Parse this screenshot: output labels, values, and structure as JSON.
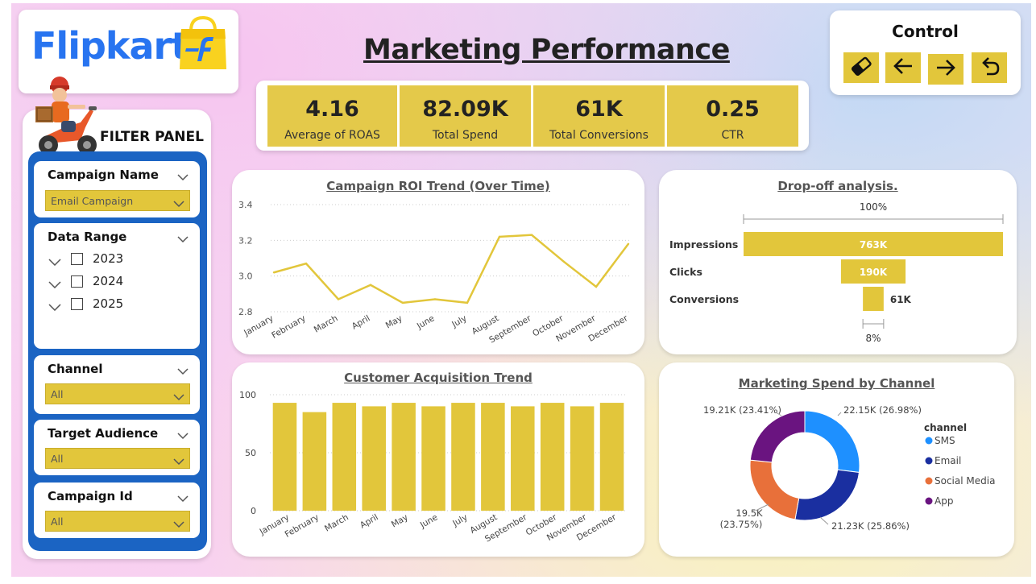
{
  "brand": {
    "name": "Flipkart",
    "color": "#2874f0",
    "bag_color": "#f9d21f"
  },
  "page_title": "Marketing Performance",
  "control": {
    "title": "Control",
    "buttons": [
      "eraser-icon",
      "arrow-left-icon",
      "arrow-right-icon",
      "undo-icon"
    ]
  },
  "kpis": [
    {
      "value": "4.16",
      "label": "Average of ROAS"
    },
    {
      "value": "82.09K",
      "label": "Total Spend"
    },
    {
      "value": "61K",
      "label": "Total Conversions"
    },
    {
      "value": "0.25",
      "label": "CTR"
    }
  ],
  "filter_panel": {
    "title": "FILTER PANEL",
    "campaign_name": {
      "label": "Campaign Name",
      "value": "Email Campaign"
    },
    "data_range": {
      "label": "Data Range",
      "years": [
        "2023",
        "2024",
        "2025"
      ]
    },
    "channel": {
      "label": "Channel",
      "value": "All"
    },
    "target_audience": {
      "label": "Target Audience",
      "value": "All"
    },
    "campaign_id": {
      "label": "Campaign Id",
      "value": "All"
    }
  },
  "accent_color": "#e2c63b",
  "chart_data": [
    {
      "type": "line",
      "title": "Campaign ROI Trend (Over Time)",
      "categories": [
        "January",
        "February",
        "March",
        "April",
        "May",
        "June",
        "July",
        "August",
        "September",
        "October",
        "November",
        "December"
      ],
      "values": [
        3.02,
        3.07,
        2.87,
        2.95,
        2.85,
        2.87,
        2.85,
        3.22,
        3.23,
        3.08,
        2.94,
        3.18
      ],
      "ylim": [
        2.8,
        3.4
      ],
      "yticks": [
        "3.4",
        "3.2",
        "3.0",
        "2.8"
      ],
      "xlabel": "",
      "ylabel": "",
      "grid": true,
      "color": "#e2c63b"
    },
    {
      "type": "bar",
      "title": "Drop-off analysis.",
      "categories": [
        "Impressions",
        "Clicks",
        "Conversions"
      ],
      "values": [
        763,
        190,
        61
      ],
      "data_labels": [
        "763K",
        "190K",
        "61K"
      ],
      "top_label": "100%",
      "bottom_label": "8%",
      "color": "#e2c63b"
    },
    {
      "type": "bar",
      "title": "Customer Acquisition Trend",
      "categories": [
        "January",
        "February",
        "March",
        "April",
        "May",
        "June",
        "July",
        "August",
        "September",
        "October",
        "November",
        "December"
      ],
      "values": [
        93,
        85,
        93,
        90,
        93,
        90,
        93,
        93,
        90,
        93,
        90,
        93
      ],
      "ylim": [
        0,
        100
      ],
      "yticks": [
        "100",
        "50",
        "0"
      ],
      "xlabel": "",
      "ylabel": "",
      "grid": true,
      "color": "#e2c63b"
    },
    {
      "type": "pie",
      "title": "Marketing Spend by Channel",
      "legend_title": "channel",
      "legend_position": "right",
      "categories": [
        "SMS",
        "Email",
        "Social Media",
        "App"
      ],
      "values": [
        22.15,
        21.23,
        19.5,
        19.21
      ],
      "data_labels": [
        "22.15K (26.98%)",
        "21.23K (25.86%)",
        "19.5K (23.75%)",
        "19.21K (23.41%)"
      ],
      "colors": [
        "#1e90ff",
        "#1a2fa0",
        "#e8703a",
        "#6a1480"
      ]
    }
  ]
}
